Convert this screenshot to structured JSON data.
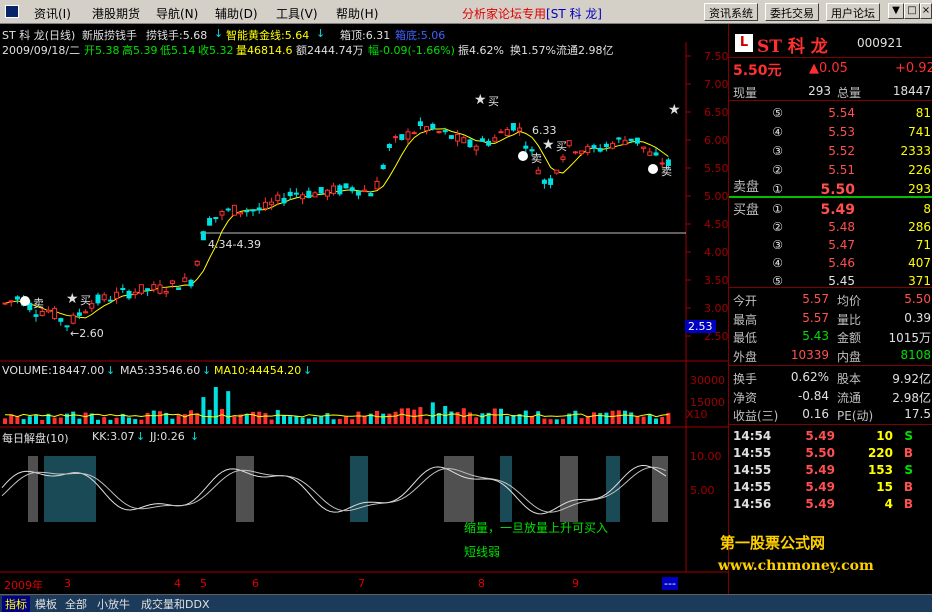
{
  "menubar": {
    "items": [
      "资讯(I)",
      "港股期货",
      "导航(N)",
      "辅助(D)",
      "工具(V)",
      "帮助(H)"
    ],
    "forum_title": "分析家论坛专用",
    "forum_code": "[ST 科 龙]",
    "buttons": [
      "资讯系统",
      "委托交易",
      "用户论坛"
    ],
    "window_buttons": [
      "▼",
      "□",
      "×"
    ]
  },
  "header": {
    "line1_stock": "ST 科 龙(日线)",
    "line1_indicator": "新版捞钱手",
    "line1_lqs": "捞钱手:5.68",
    "line1_hjx": "智能黄金线:5.64",
    "line1_xd": "箱顶:6.31",
    "line1_xdi": "箱底:5.06",
    "line2_date": "2009/09/18/二",
    "line2_open": "开5.38",
    "line2_high": "高5.39",
    "line2_low": "低5.14",
    "line2_close": "收5.32",
    "line2_vol": "量46814.6",
    "line2_amt": "额2444.74万",
    "line2_chg": "幅-0.09(-1.66%)",
    "line2_amp": "振4.62%",
    "line2_turn": "换1.57%",
    "line2_float": "流通2.98亿"
  },
  "annotations": {
    "buy": "买",
    "sell": "卖",
    "low_label": "←2.60",
    "box_label": "4.34-4.39",
    "high_label": "6.33",
    "current_price_tag": "2.53",
    "bottom_note": "缩量，一旦放量上升可买入",
    "bottom_note2": "短线弱"
  },
  "volume_panel": {
    "label": "VOLUME:18447.00",
    "ma5": "MA5:33546.60",
    "ma10": "MA10:44454.20",
    "axis": [
      "30000",
      "15000",
      "X10"
    ]
  },
  "osc_panel": {
    "label": "每日解盘(10)",
    "kk": "KK:3.07",
    "jj": "JJ:0.26",
    "axis": [
      "10.00",
      "5.00"
    ]
  },
  "price_axis": [
    "7.50",
    "7.00",
    "6.50",
    "6.00",
    "5.50",
    "5.00",
    "4.50",
    "4.00",
    "3.50",
    "3.00",
    "2.50"
  ],
  "time_axis": {
    "year": "2009年",
    "months": [
      "3",
      "4",
      "5",
      "6",
      "7",
      "8",
      "9"
    ],
    "more": "---"
  },
  "quote": {
    "badge": "L",
    "name": "ST 科 龙",
    "code": "000921",
    "price": "5.50元",
    "change": "▲0.05",
    "pct": "+0.92",
    "xianliang_label": "现量",
    "xianliang": "293",
    "zongliang_label": "总量",
    "zongliang": "18447",
    "sell_label": "卖盘",
    "buy_label": "买盘",
    "asks": [
      {
        "n": "⑤",
        "p": "5.54",
        "v": "81"
      },
      {
        "n": "④",
        "p": "5.53",
        "v": "741"
      },
      {
        "n": "③",
        "p": "5.52",
        "v": "2333"
      },
      {
        "n": "②",
        "p": "5.51",
        "v": "226"
      },
      {
        "n": "①",
        "p": "5.50",
        "v": "293"
      }
    ],
    "bids": [
      {
        "n": "①",
        "p": "5.49",
        "v": "8"
      },
      {
        "n": "②",
        "p": "5.48",
        "v": "286"
      },
      {
        "n": "③",
        "p": "5.47",
        "v": "71"
      },
      {
        "n": "④",
        "p": "5.46",
        "v": "407"
      },
      {
        "n": "⑤",
        "p": "5.45",
        "v": "371"
      }
    ],
    "stats": [
      {
        "l1": "今开",
        "v1": "5.57",
        "l2": "均价",
        "v2": "5.50"
      },
      {
        "l1": "最高",
        "v1": "5.57",
        "l2": "量比",
        "v2": "0.39"
      },
      {
        "l1": "最低",
        "v1": "5.43",
        "l2": "金额",
        "v2": "1015万"
      },
      {
        "l1": "外盘",
        "v1": "10339",
        "l2": "内盘",
        "v2": "8108"
      }
    ],
    "fund": [
      {
        "l1": "换手",
        "v1": "0.62%",
        "l2": "股本",
        "v2": "9.92亿"
      },
      {
        "l1": "净资",
        "v1": "-0.84",
        "l2": "流通",
        "v2": "2.98亿"
      },
      {
        "l1": "收益(三)",
        "v1": "0.16",
        "l2": "PE(动)",
        "v2": "17.5"
      }
    ],
    "ticks": [
      {
        "t": "14:54",
        "p": "5.49",
        "v": "10",
        "s": "S"
      },
      {
        "t": "14:55",
        "p": "5.50",
        "v": "220",
        "s": "B"
      },
      {
        "t": "14:55",
        "p": "5.49",
        "v": "153",
        "s": "S"
      },
      {
        "t": "14:55",
        "p": "5.49",
        "v": "15",
        "s": "B"
      },
      {
        "t": "14:56",
        "p": "5.49",
        "v": "4",
        "s": "B"
      }
    ]
  },
  "watermark": {
    "line1": "第一股票公式网",
    "line2": "www.chnmoney.com"
  },
  "bottom_tabs": [
    "指标",
    "模板",
    "全部",
    "小放牛",
    "成交量和DDX"
  ],
  "colors": {
    "up": "#ff3030",
    "down": "#00e0e0",
    "ma_yellow": "#ffff00",
    "axis_red": "#a00000"
  }
}
